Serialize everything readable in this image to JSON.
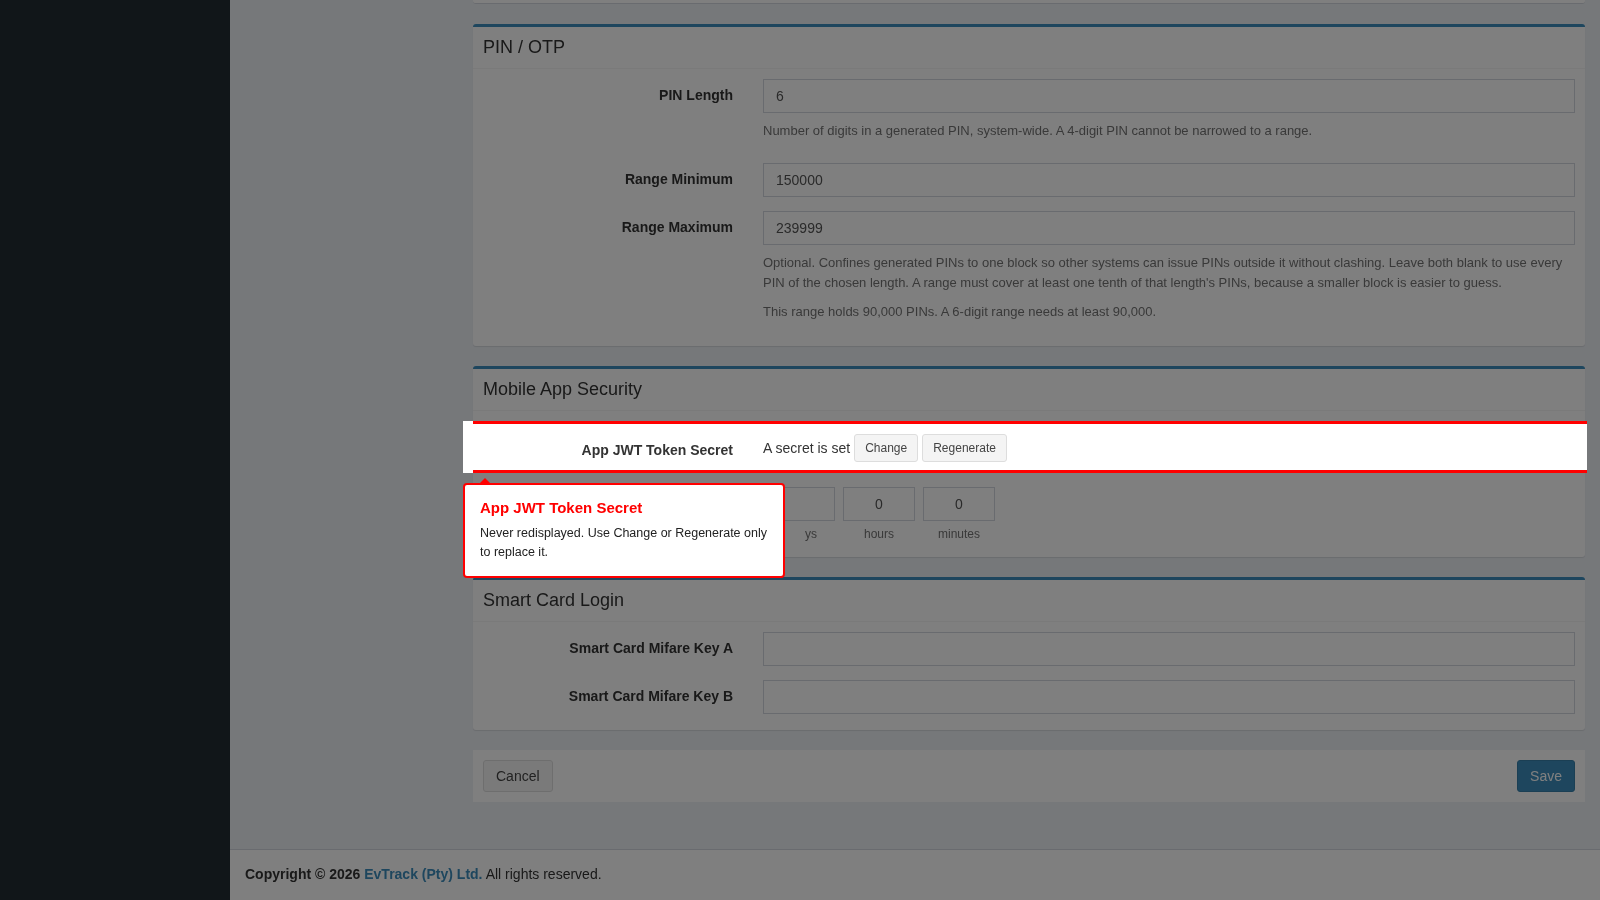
{
  "sections": [
    {
      "title": "PIN / OTP",
      "fields": [
        {
          "kind": "input",
          "label": "PIN Length",
          "value": "6",
          "highlighted": false,
          "help": [
            "Number of digits in a generated PIN, system-wide. A 4-digit PIN cannot be narrowed to a range."
          ]
        },
        {
          "kind": "input",
          "label": "Range Minimum",
          "value": "150000",
          "highlighted": false
        },
        {
          "kind": "input",
          "label": "Range Maximum",
          "value": "239999",
          "highlighted": false,
          "help": [
            "Optional. Confines generated PINs to one block so other systems can issue PINs outside it without clashing. Leave both blank to use every PIN of the chosen length. A range must cover at least one tenth of that length's PINs, because a smaller block is easier to guess.",
            "This range holds 90,000 PINs. A 6-digit range needs at least 90,000."
          ]
        }
      ]
    },
    {
      "title": "Mobile App Security",
      "fields": [
        {
          "kind": "secret",
          "label": "App JWT Token Secret",
          "status": "A secret is set",
          "buttons": [
            "Change",
            "Regenerate"
          ],
          "highlighted": true
        },
        {
          "kind": "duration",
          "highlighted": false,
          "parts": [
            {
              "unit": "ys"
            },
            {
              "value": "0",
              "unit": "hours"
            },
            {
              "value": "0",
              "unit": "minutes"
            }
          ]
        }
      ]
    },
    {
      "title": "Smart Card Login",
      "fields": [
        {
          "kind": "input",
          "label": "Smart Card Mifare Key A",
          "highlighted": false
        },
        {
          "kind": "input",
          "label": "Smart Card Mifare Key B",
          "highlighted": false
        }
      ]
    }
  ],
  "tooltip": {
    "title": "App JWT Token Secret",
    "text": "Never redisplayed. Use Change or Regenerate only to replace it."
  },
  "actions": {
    "cancel": "Cancel",
    "save": "Save"
  },
  "footer": {
    "prefix": "**Copyright © 2026**",
    "link": "EvTrack (Pty) Ltd.",
    "suffix": "All rights reserved."
  }
}
